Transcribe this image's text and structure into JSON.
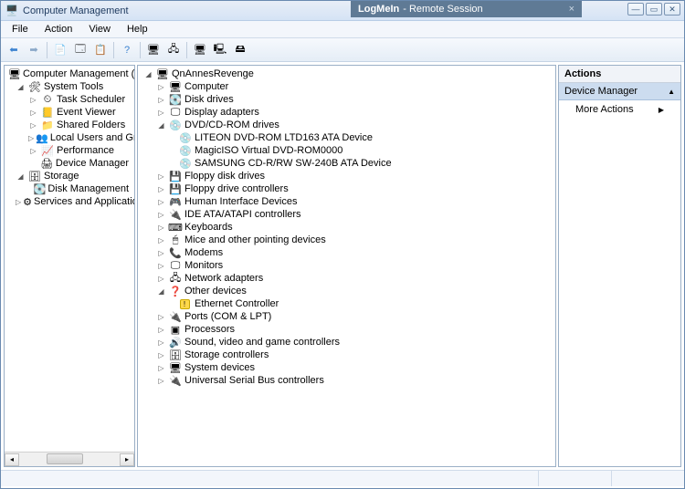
{
  "titlebar": {
    "title": "Computer Management",
    "remote_brand": "LogMeIn",
    "remote_label": " - Remote Session"
  },
  "menu": {
    "file": "File",
    "action": "Action",
    "view": "View",
    "help": "Help"
  },
  "left_tree": {
    "root": "Computer Management (Local)",
    "system_tools": "System Tools",
    "task_scheduler": "Task Scheduler",
    "event_viewer": "Event Viewer",
    "shared_folders": "Shared Folders",
    "local_users": "Local Users and Groups",
    "performance": "Performance",
    "device_manager": "Device Manager",
    "storage": "Storage",
    "disk_management": "Disk Management",
    "services": "Services and Applications"
  },
  "center_tree": {
    "root": "QnAnnesRevenge",
    "computer": "Computer",
    "disk_drives": "Disk drives",
    "display_adapters": "Display adapters",
    "dvd": "DVD/CD-ROM drives",
    "dvd_1": "LITEON DVD-ROM LTD163 ATA Device",
    "dvd_2": "MagicISO Virtual DVD-ROM0000",
    "dvd_3": "SAMSUNG CD-R/RW SW-240B ATA Device",
    "floppy_drives": "Floppy disk drives",
    "floppy_ctrl": "Floppy drive controllers",
    "hid": "Human Interface Devices",
    "ide": "IDE ATA/ATAPI controllers",
    "keyboards": "Keyboards",
    "mice": "Mice and other pointing devices",
    "modems": "Modems",
    "monitors": "Monitors",
    "network": "Network adapters",
    "other": "Other devices",
    "ethernet": "Ethernet Controller",
    "ports": "Ports (COM & LPT)",
    "processors": "Processors",
    "sound": "Sound, video and game controllers",
    "storage_ctrl": "Storage controllers",
    "system_devices": "System devices",
    "usb": "Universal Serial Bus controllers"
  },
  "actions": {
    "title": "Actions",
    "header": "Device Manager",
    "more": "More Actions"
  }
}
